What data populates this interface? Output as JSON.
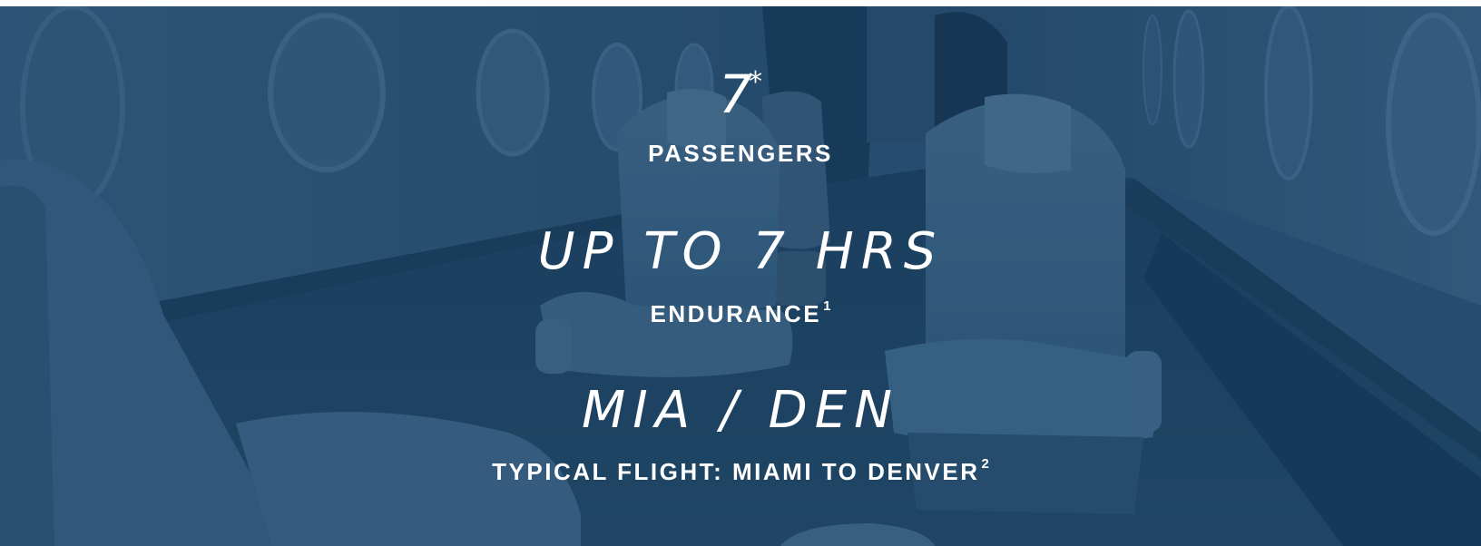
{
  "hero": {
    "background": "private jet cabin interior with blue duotone overlay",
    "overlay_color": "#2e5270",
    "text_color": "#ffffff"
  },
  "stats": [
    {
      "value": "7",
      "value_mark": "*",
      "label": "PASSENGERS",
      "label_mark": ""
    },
    {
      "value": "UP TO 7 HRS",
      "value_mark": "",
      "label": "ENDURANCE",
      "label_mark": "1"
    },
    {
      "value": "MIA / DEN",
      "value_mark": "",
      "label": "TYPICAL FLIGHT: MIAMI TO DENVER",
      "label_mark": "2"
    }
  ]
}
